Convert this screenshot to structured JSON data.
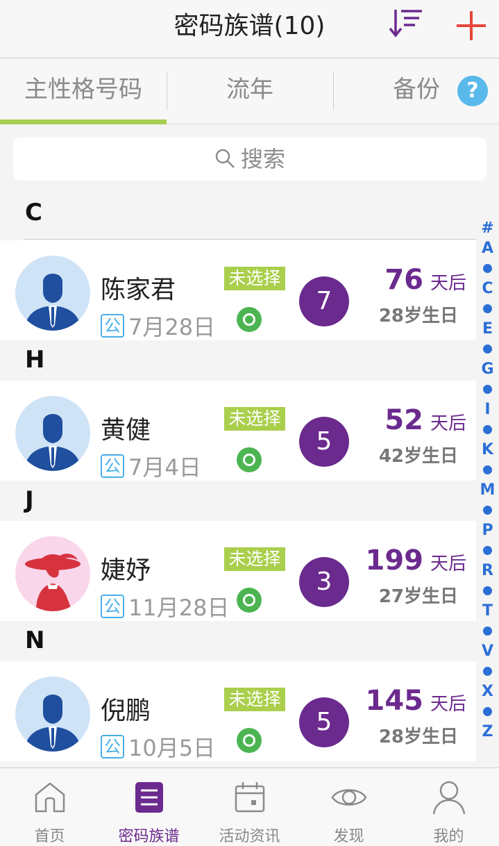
{
  "header": {
    "title": "密码族谱(10)",
    "sort_icon": "sort-descending-icon",
    "add_icon": "plus-icon"
  },
  "tabs": [
    {
      "label": "主性格号码",
      "active": true
    },
    {
      "label": "流年",
      "active": false
    },
    {
      "label": "备份",
      "active": false
    }
  ],
  "help": {
    "label": "?"
  },
  "search": {
    "placeholder": "搜索"
  },
  "sections": [
    {
      "letter": "C",
      "contacts": [
        {
          "name": "陈家君",
          "calendar": "公",
          "date": "7月28日",
          "status": "未选择",
          "number": "7",
          "days": "76",
          "days_unit": "天后",
          "birthday": "28岁生日",
          "avatar": "male-avatar"
        }
      ]
    },
    {
      "letter": "H",
      "contacts": [
        {
          "name": "黄健",
          "calendar": "公",
          "date": "7月4日",
          "status": "未选择",
          "number": "5",
          "days": "52",
          "days_unit": "天后",
          "birthday": "42岁生日",
          "avatar": "male-avatar"
        }
      ]
    },
    {
      "letter": "J",
      "contacts": [
        {
          "name": "婕妤",
          "calendar": "公",
          "date": "11月28日",
          "status": "未选择",
          "number": "3",
          "days": "199",
          "days_unit": "天后",
          "birthday": "27岁生日",
          "avatar": "female-avatar"
        }
      ]
    },
    {
      "letter": "N",
      "contacts": [
        {
          "name": "倪鹏",
          "calendar": "公",
          "date": "10月5日",
          "status": "未选择",
          "number": "5",
          "days": "145",
          "days_unit": "天后",
          "birthday": "28岁生日",
          "avatar": "male-avatar"
        }
      ]
    }
  ],
  "index": [
    "#",
    "A",
    "•",
    "C",
    "•",
    "E",
    "•",
    "G",
    "•",
    "I",
    "•",
    "K",
    "•",
    "M",
    "•",
    "P",
    "•",
    "R",
    "•",
    "T",
    "•",
    "V",
    "•",
    "X",
    "•",
    "Z"
  ],
  "bottom_nav": [
    {
      "label": "首页",
      "icon": "home-icon",
      "active": false
    },
    {
      "label": "密码族谱",
      "icon": "list-icon",
      "active": true
    },
    {
      "label": "活动资讯",
      "icon": "calendar-icon",
      "active": false
    },
    {
      "label": "发现",
      "icon": "eye-icon",
      "active": false
    },
    {
      "label": "我的",
      "icon": "user-icon",
      "active": false
    }
  ],
  "colors": {
    "accent_purple": "#6b2a8e",
    "status_green": "#a9cf4c",
    "tab_underline": "#a6cf52",
    "index_blue": "#2b6fd6",
    "add_red": "#e8463a"
  }
}
